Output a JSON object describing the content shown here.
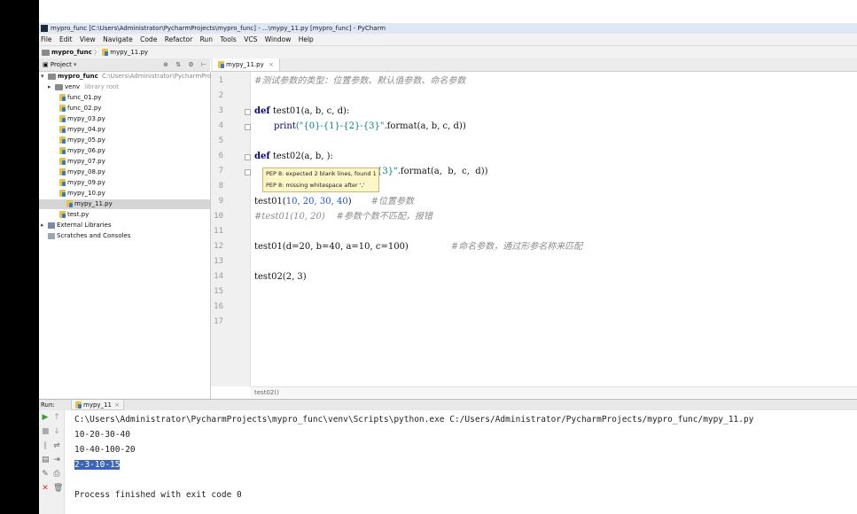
{
  "window": {
    "title": "mypro_func [C:\\Users\\Administrator\\PycharmProjects\\mypro_func] - ...\\mypy_11.py [mypro_func] - PyCharm"
  },
  "menu": [
    "File",
    "Edit",
    "View",
    "Navigate",
    "Code",
    "Refactor",
    "Run",
    "Tools",
    "VCS",
    "Window",
    "Help"
  ],
  "navbar": {
    "project": "mypro_func",
    "file": "mypy_11.py"
  },
  "project_panel": {
    "header": "Project",
    "root_name": "mypro_func",
    "root_path": "C:\\Users\\Administrator\\PycharmProjects",
    "venv": "venv",
    "venv_note": "library root",
    "files": [
      "func_01.py",
      "func_02.py",
      "mypy_03.py",
      "mypy_04.py",
      "mypy_05.py",
      "mypy_06.py",
      "mypy_07.py",
      "mypy_08.py",
      "mypy_09.py",
      "mypy_10.py",
      "mypy_11.py",
      "test.py"
    ],
    "selected_file": "mypy_11.py",
    "external": "External Libraries",
    "scratches": "Scratches and Consoles"
  },
  "editor": {
    "tab": "mypy_11.py",
    "line_numbers": [
      "1",
      "2",
      "3",
      "4",
      "5",
      "6",
      "7",
      "8",
      "9",
      "10",
      "11",
      "12",
      "13",
      "14",
      "15",
      "16",
      "17"
    ],
    "lines": {
      "l1_comment": "#测试参数的类型：位置参数、默认值参数、命名参数",
      "l3_kw": "def",
      "l3_rest": " test01(a, b, c, d):",
      "l4_fn": "print",
      "l4_str": "(\"{0}-{1}-{2}-{3}\"",
      "l4_rest": ".format(a, b, c, d))",
      "l6_kw": "def",
      "l6_rest": " test02(a, b, ):",
      "l7_str": "{3}\"",
      "l7_rest": ".format(a,  b,  c,  d))",
      "l9_code": "test01(",
      "l9_nums": "10, 20, 30, 40",
      "l9_close": ")",
      "l9_comment": "#位置参数",
      "l10_comment": "#test01(10, 20)    #参数个数不匹配，报错",
      "l12_code": "test01(d=20, b=40, a=10, c=100)",
      "l12_comment": "#命名参数，通过形参名称来匹配",
      "l14_code": "test02(2, 3)"
    },
    "tooltip": [
      "PEP 8: expected 2 blank lines, found 1",
      "PEP 8: missing whitespace after ','"
    ],
    "breadcrumb": "test02()"
  },
  "run": {
    "label": "Run:",
    "tab": "mypy_11",
    "output": [
      "C:\\Users\\Administrator\\PycharmProjects\\mypro_func\\venv\\Scripts\\python.exe C:/Users/Administrator/PycharmProjects/mypro_func/mypy_11.py",
      "10-20-30-40",
      "10-40-100-20",
      "2-3-10-15",
      "",
      "Process finished with exit code 0"
    ]
  }
}
